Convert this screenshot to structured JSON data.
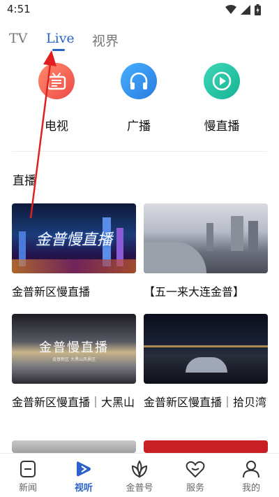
{
  "status": {
    "time": "4:51"
  },
  "tabs": [
    {
      "label": "TV"
    },
    {
      "label": "Live"
    },
    {
      "label": "视界"
    }
  ],
  "channels": [
    {
      "label": "电视",
      "icon": "tv-icon",
      "color": "#f2665a"
    },
    {
      "label": "广播",
      "icon": "headphones-icon",
      "color": "#2b8fe8"
    },
    {
      "label": "慢直播",
      "icon": "play-icon",
      "color": "#1fc0a8"
    }
  ],
  "section": {
    "title": "直播"
  },
  "cards": [
    {
      "title": "金普新区慢直播",
      "overlay": "金普慢直播"
    },
    {
      "title": "【五一来大连金普】",
      "overlay": ""
    },
    {
      "title": "金普新区慢直播｜大黑山",
      "overlay": "金普慢直播",
      "overlay_sub": "金普新区 大黑山风景区"
    },
    {
      "title": "金普新区慢直播｜拾贝湾",
      "overlay": ""
    }
  ],
  "nav": [
    {
      "label": "新闻",
      "icon": "news-icon"
    },
    {
      "label": "视听",
      "icon": "play-icon"
    },
    {
      "label": "金普号",
      "icon": "leaf-icon"
    },
    {
      "label": "服务",
      "icon": "heart-icon"
    },
    {
      "label": "我的",
      "icon": "profile-icon"
    }
  ],
  "colors": {
    "accent": "#2a62c9",
    "arrow": "#e02020"
  }
}
